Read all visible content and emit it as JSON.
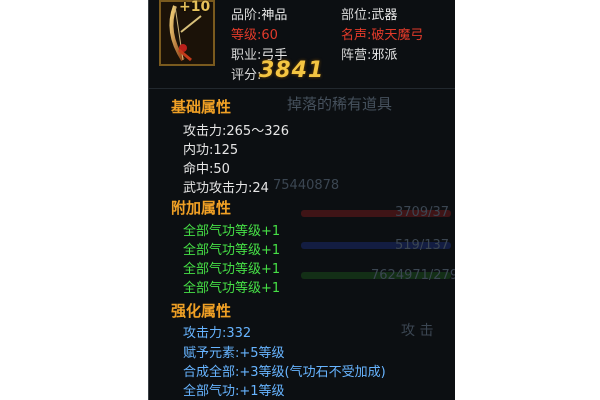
{
  "item": {
    "enhance_level": "+10",
    "grade_label": "品阶:",
    "grade_value": "神品",
    "slot_label": "部位:",
    "slot_value": "武器",
    "level_label": "等级:",
    "level_value": "60",
    "fame_label": "名声:",
    "fame_value": "破天魔弓",
    "class_label": "职业:",
    "class_value": "弓手",
    "faction_label": "阵营:",
    "faction_value": "邪派",
    "score_label": "评分:",
    "score_value": "3841"
  },
  "sections": {
    "base": {
      "title": "基础属性",
      "stats": [
        "攻击力:265～326",
        "内功:125",
        "命中:50",
        "武功攻击力:24"
      ]
    },
    "extra": {
      "title": "附加属性",
      "stats": [
        "全部气功等级+1",
        "全部气功等级+1",
        "全部气功等级+1",
        "全部气功等级+1"
      ]
    },
    "enhance": {
      "title": "强化属性",
      "stats": [
        "攻击力:332",
        "赋予元素:+5等级",
        "合成全部:+3等级(气功石不受加成)",
        "全部气功:+1等级"
      ]
    }
  },
  "background": {
    "drop_text": "掉落的稀有道具",
    "number_text": "75440878",
    "bar1_text": "3709/37",
    "bar2_text": "519/137",
    "bar3_text": "7624971/279",
    "side_text": "攻 击"
  },
  "colors": {
    "panel": "#0c0f12",
    "gold": "#f4c542",
    "section": "#f0a025",
    "green": "#46e046",
    "blue": "#67b4ff",
    "red": "#e03a2a"
  },
  "icons": {
    "item_icon": "bow-weapon-icon"
  }
}
